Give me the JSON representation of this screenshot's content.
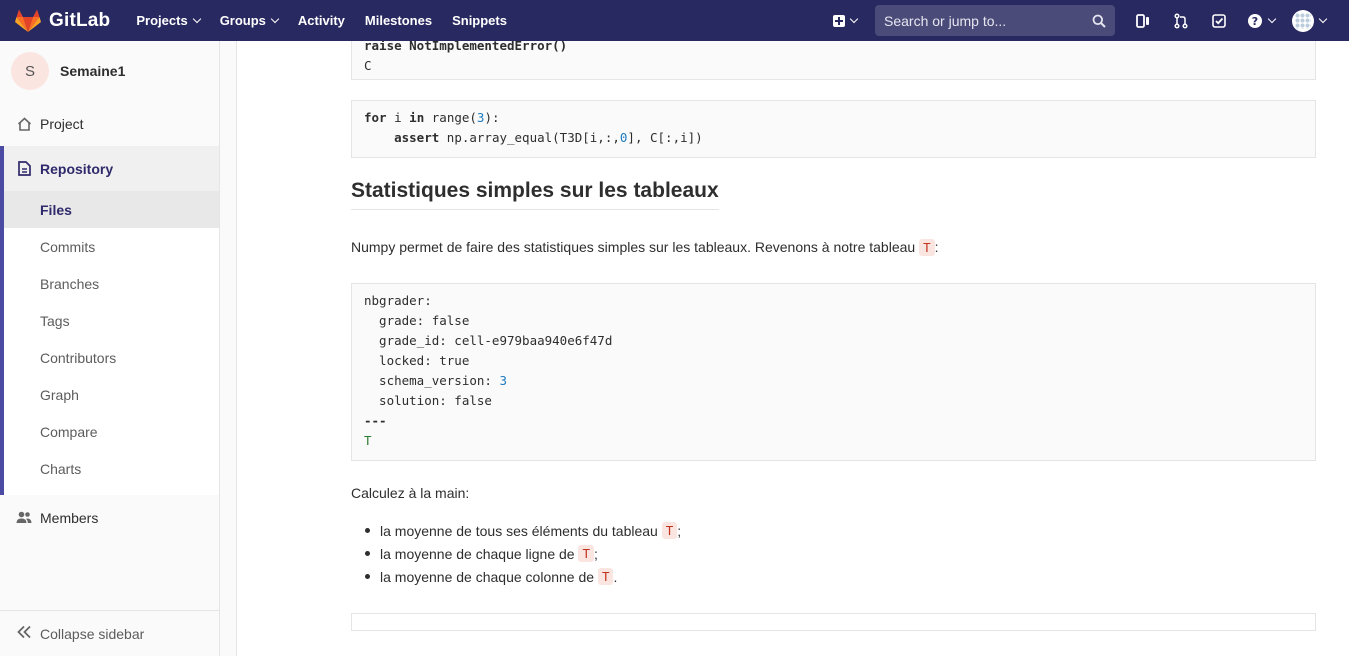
{
  "topbar": {
    "brand": "GitLab",
    "nav": [
      {
        "label": "Projects",
        "dropdown": true
      },
      {
        "label": "Groups",
        "dropdown": true
      },
      {
        "label": "Activity",
        "dropdown": false
      },
      {
        "label": "Milestones",
        "dropdown": false
      },
      {
        "label": "Snippets",
        "dropdown": false
      }
    ],
    "search_placeholder": "Search or jump to...",
    "colors": {
      "bar": "#292961",
      "logo_orange": "#fc6d26",
      "logo_red": "#e24329",
      "logo_light": "#fca326"
    }
  },
  "sidebar": {
    "project_initial": "S",
    "project_name": "Semaine1",
    "project_label": "Project",
    "repository_label": "Repository",
    "repo_items": [
      "Files",
      "Commits",
      "Branches",
      "Tags",
      "Contributors",
      "Graph",
      "Compare",
      "Charts"
    ],
    "active_item": "Files",
    "members_label": "Members",
    "collapse_label": "Collapse sidebar"
  },
  "content": {
    "code_top_partial": "raise NotImplementedError()",
    "code_top_line2": "C",
    "code2_line1_kw": "for",
    "code2_line1_var": "i",
    "code2_line1_in": "in",
    "code2_line1_rest": "range(",
    "code2_line1_num": "3",
    "code2_line1_end": "):",
    "code2_line2_kw": "assert",
    "code2_line2_a": "np.array_equal(T3D[i,:,",
    "code2_line2_num": "0",
    "code2_line2_b": "], C[:,i])",
    "heading": "Statistiques simples sur les tableaux",
    "intro_text": "Numpy permet de faire des statistiques simples sur les tableaux. Revenons à notre tableau",
    "intro_code": "T",
    "intro_end": ":",
    "meta": {
      "l1": "nbgrader:",
      "l2": "  grade: false",
      "l3": "  grade_id: cell-e979baa940e6f47d",
      "l4": "  locked: true",
      "l5a": "  schema_version: ",
      "l5num": "3",
      "l6": "  solution: false",
      "l7": "---",
      "l8": "T"
    },
    "calc_label": "Calculez à la main:",
    "bullets": [
      {
        "text": "la moyenne de tous ses éléments du tableau",
        "code": "T",
        "end": ";"
      },
      {
        "text": "la moyenne de chaque ligne de",
        "code": "T",
        "end": ";"
      },
      {
        "text": "la moyenne de chaque colonne de",
        "code": "T",
        "end": "."
      }
    ]
  }
}
